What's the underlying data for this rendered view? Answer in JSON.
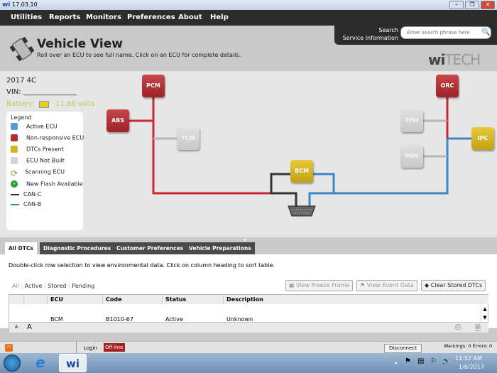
{
  "window": {
    "title": "17.03.10",
    "logo": "wi"
  },
  "menu": [
    "Utilities",
    "Reports",
    "Monitors",
    "Preferences",
    "About",
    "Help"
  ],
  "search": {
    "label1": "Search",
    "label2": "Service Information",
    "placeholder": "Enter search phrase here"
  },
  "header": {
    "title": "Vehicle View",
    "subtitle": "Roll over an ECU to see full name. Click on an ECU for complete details.",
    "brand_a": "wi",
    "brand_b": "TECH"
  },
  "vehicle": {
    "model": "2017 4C",
    "vin_label": "VIN: _______________",
    "battery_label": "Battery:",
    "battery_value": "11.88 volts"
  },
  "legend": {
    "title": "Legend",
    "items": [
      "Active ECU",
      "Non-responsive ECU",
      "DTCs Present",
      "ECU Not Built",
      "Scanning ECU",
      "New Flash Available",
      "CAN-C",
      "CAN-B"
    ]
  },
  "colors": {
    "active": "#5b9bd5",
    "nonresponsive": "#b0302f",
    "dtc": "#d4b324",
    "notbuilt": "#d4d4d4",
    "canc": "#333333",
    "canb": "#3d85c6"
  },
  "ecus": {
    "pcm": "PCM",
    "abs": "ABS",
    "tcm": "TCM",
    "bcm": "BCM",
    "orc": "ORC",
    "tpm": "TPM",
    "pam": "PAM",
    "ipc": "IPC"
  },
  "tabs": [
    "All DTCs",
    "Diagnostic Procedures",
    "Customer Preferences",
    "Vehicle Preparations"
  ],
  "dtc": {
    "hint": "Double-click row selection to view environmental data.  Click on column heading to sort table.",
    "filters": [
      "All",
      "Active",
      "Stored",
      "Pending"
    ],
    "buttons": {
      "freeze": "View Freeze Frame",
      "event": "View Event Data",
      "clear": "Clear Stored DTCs"
    },
    "columns": [
      "ECU",
      "Code",
      "Status",
      "Description"
    ],
    "rows": [
      {
        "ecu": "BCM",
        "code": "B1010-67",
        "status": "Active",
        "description": "Unknown"
      }
    ],
    "font_small": "A",
    "font_large": "A"
  },
  "status": {
    "login": "Login",
    "offline": "Off-line",
    "disconnect": "Disconnect",
    "warnings": "Warnings: 0 Errors: 0"
  },
  "taskbar": {
    "time": "11:52 AM",
    "date": "1/6/2017",
    "app": "wi"
  }
}
